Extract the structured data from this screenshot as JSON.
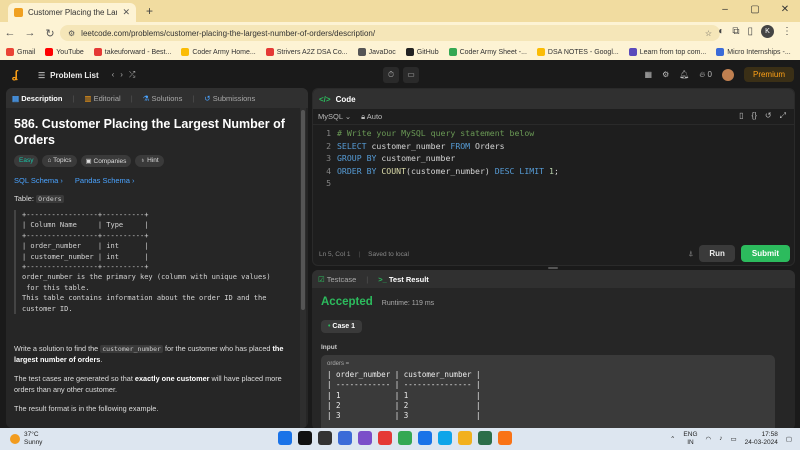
{
  "browser": {
    "tab_title": "Customer Placing the Largest N",
    "url": "leetcode.com/problems/customer-placing-the-largest-number-of-orders/description/",
    "bookmarks": [
      {
        "label": "Gmail",
        "color": "#ea4335"
      },
      {
        "label": "YouTube",
        "color": "#ff0000"
      },
      {
        "label": "takeuforward - Best...",
        "color": "#e53935"
      },
      {
        "label": "Coder Army Home...",
        "color": "#fbbc04"
      },
      {
        "label": "Strivers A2Z DSA Co...",
        "color": "#e53935"
      },
      {
        "label": "JavaDoc",
        "color": "#555555"
      },
      {
        "label": "GitHub",
        "color": "#222222"
      },
      {
        "label": "Coder Army Sheet -...",
        "color": "#34a853"
      },
      {
        "label": "DSA NOTES - Googl...",
        "color": "#fbbc04"
      },
      {
        "label": "Learn from top com...",
        "color": "#5b4bbb"
      },
      {
        "label": "Micro Internships -...",
        "color": "#3b6bd8"
      }
    ],
    "profile_initial": "K"
  },
  "lc_nav": {
    "problem_list": "Problem List",
    "streak": "0",
    "premium": "Premium"
  },
  "left_panel": {
    "tabs": [
      "Description",
      "Editorial",
      "Solutions",
      "Submissions"
    ],
    "title": "586. Customer Placing the Largest Number of Orders",
    "chips": [
      "Easy",
      "Topics",
      "Companies",
      "Hint"
    ],
    "schemas": [
      "SQL Schema",
      "Pandas Schema"
    ],
    "table_label": "Table:",
    "table_name": "Orders",
    "schema_pre": "+-----------------+----------+\n| Column Name     | Type     |\n+-----------------+----------+\n| order_number    | int      |\n| customer_number | int      |\n+-----------------+----------+\norder_number is the primary key (column with unique values)\n for this table.\nThis table contains information about the order ID and the\ncustomer ID.",
    "para1_a": "Write a solution to find the ",
    "para1_code": "customer_number",
    "para1_b": " for the customer who has placed ",
    "para1_bold": "the largest number of orders",
    "para1_c": ".",
    "para2_a": "The test cases are generated so that ",
    "para2_bold": "exactly one customer",
    "para2_b": " will have placed more orders than any other customer.",
    "para3": "The result format is in the following example."
  },
  "code_panel": {
    "header": "Code",
    "language": "MySQL",
    "mode": "Auto",
    "line_numbers": [
      "1",
      "2",
      "3",
      "4",
      "5"
    ],
    "status_pos": "Ln 5, Col 1",
    "status_saved": "Saved to local",
    "run": "Run",
    "submit": "Submit"
  },
  "test_panel": {
    "tab_testcase": "Testcase",
    "tab_result": "Test Result",
    "verdict": "Accepted",
    "runtime": "Runtime: 119 ms",
    "case": "Case 1",
    "input_label": "Input",
    "var_name": "orders =",
    "table_text": "| order_number | customer_number |\n| ------------ | --------------- |\n| 1            | 1               |\n| 2            | 2               |\n| 3            | 3               |"
  },
  "taskbar": {
    "temp": "37°C",
    "weather": "Sunny",
    "lang_1": "ENG",
    "lang_2": "IN",
    "time": "17:58",
    "date": "24-03-2024",
    "icon_colors": [
      "#1a73e8",
      "#111111",
      "#333333",
      "#3b6bd8",
      "#7b4ec9",
      "#e53935",
      "#34a853",
      "#1a73e8",
      "#0ea5e9",
      "#f2b01e",
      "#2c6e49",
      "#f97316"
    ]
  }
}
